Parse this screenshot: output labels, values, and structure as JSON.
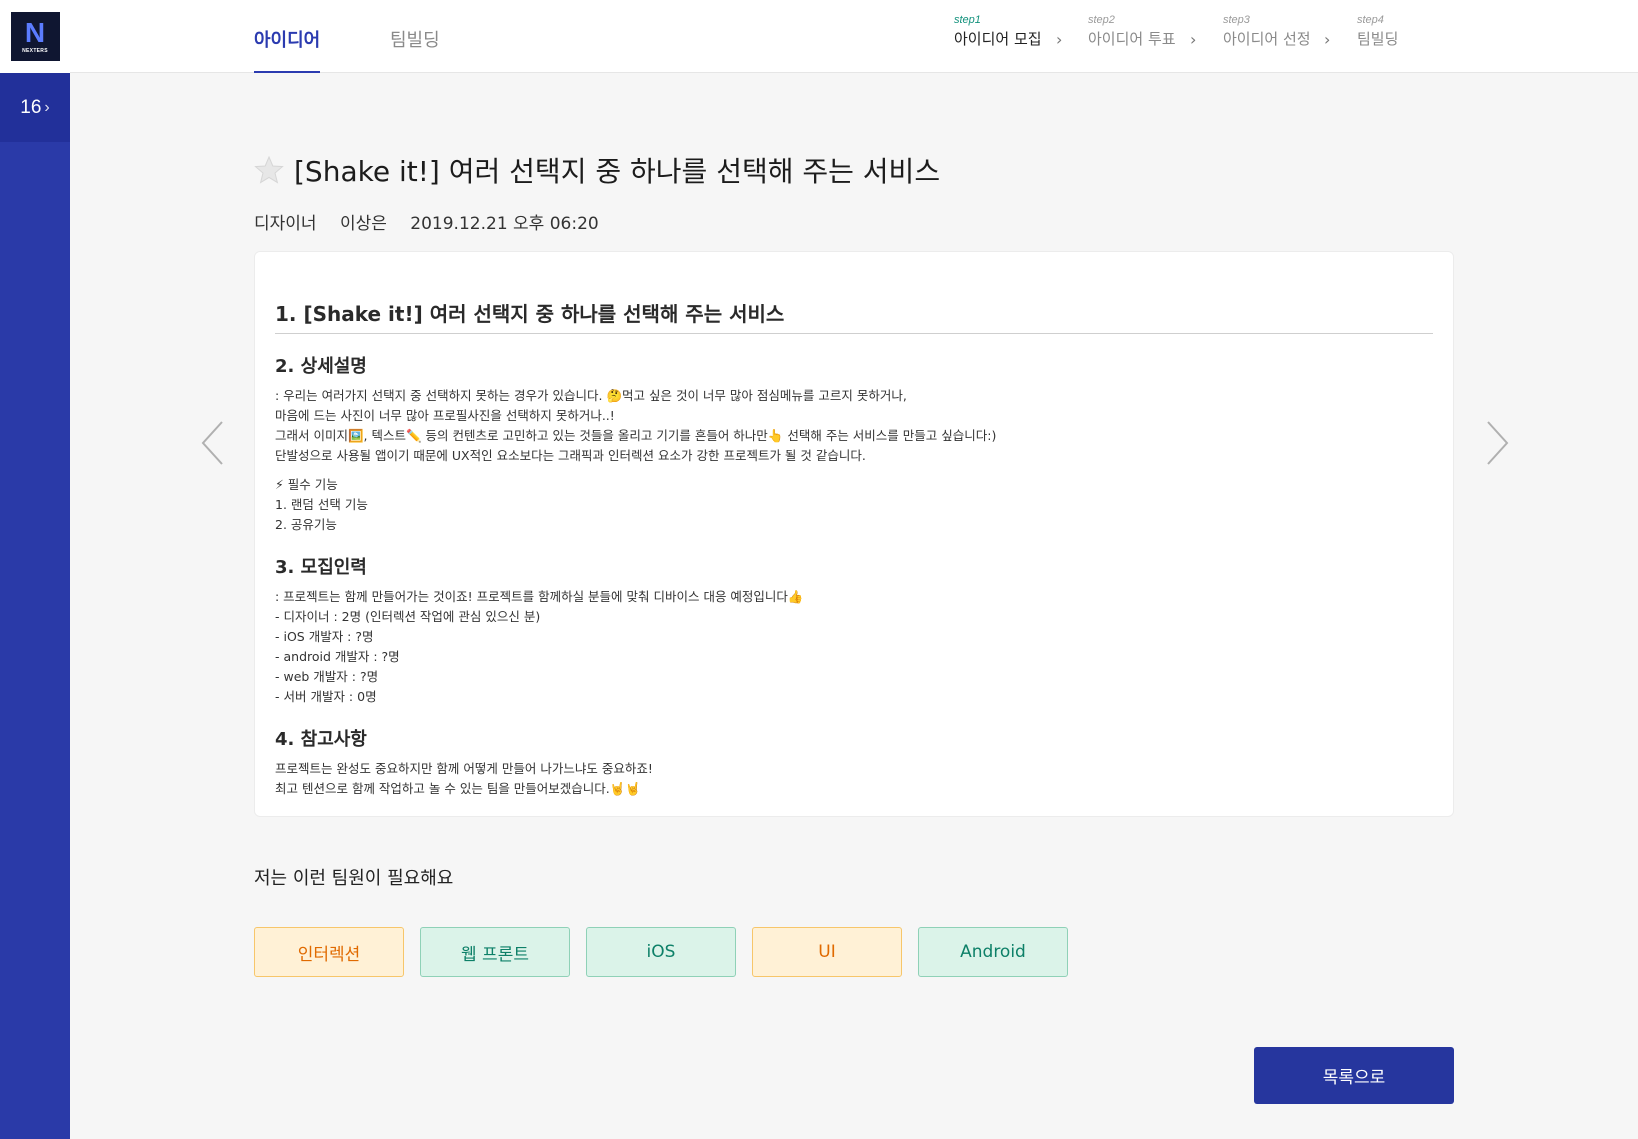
{
  "brand": {
    "logo_text": "NEXTERS"
  },
  "sidebar": {
    "generation": "16",
    "generation_chevron": "›"
  },
  "nav": {
    "tabs": [
      {
        "label": "아이디어",
        "active": true
      },
      {
        "label": "팀빌딩",
        "active": false
      }
    ],
    "steps": [
      {
        "step": "step1",
        "name": "아이디어 모집",
        "active": true
      },
      {
        "step": "step2",
        "name": "아이디어 투표",
        "active": false
      },
      {
        "step": "step3",
        "name": "아이디어 선정",
        "active": false
      },
      {
        "step": "step4",
        "name": "팀빌딩",
        "active": false
      }
    ],
    "separator": "›"
  },
  "idea": {
    "title": "[Shake it!] 여러 선택지 중 하나를 선택해 주는 서비스",
    "role": "디자이너",
    "author": "이상은",
    "date": "2019.12.21 오후 06:20"
  },
  "content": {
    "h1": "1. [Shake it!] 여러 선택지 중 하나를 선택해 주는 서비스",
    "sec2_title": "2. 상세설명",
    "sec2_lines": [
      ": 우리는 여러가지 선택지 중 선택하지 못하는 경우가 있습니다. 🤔먹고 싶은 것이 너무 많아 점심메뉴를 고르지 못하거나,",
      "마음에 드는 사진이 너무 많아 프로필사진을 선택하지 못하거나..!",
      "그래서 이미지🖼️, 텍스트✏️ 등의 컨텐츠로 고민하고 있는 것들을 올리고 기기를 흔들어 하나만👆 선택해 주는 서비스를 만들고 싶습니다:)",
      "단발성으로 사용될 앱이기 때문에 UX적인 요소보다는 그래픽과 인터렉션 요소가 강한 프로젝트가 될 것 같습니다."
    ],
    "features_lines": [
      "⚡ 필수 기능",
      "1. 랜덤 선택 기능",
      "2. 공유기능"
    ],
    "sec3_title": "3. 모집인력",
    "sec3_lines": [
      ": 프로젝트는 함께 만들어가는 것이죠! 프로젝트를 함께하실 분들에 맞춰 디바이스 대응 예정입니다👍",
      "- 디자이너 : 2명 (인터렉션 작업에 관심 있으신 분)",
      "- iOS 개발자 : ?명",
      "- android 개발자 : ?명",
      "- web 개발자 : ?명",
      "- 서버 개발자 : 0명"
    ],
    "sec4_title": "4. 참고사항",
    "sec4_lines": [
      "프로젝트는 완성도 중요하지만 함께 어떻게 만들어 나가느냐도 중요하죠!",
      "최고 텐션으로 함께 작업하고 놀 수 있는 팀을 만들어보겠습니다.🤘🤘"
    ]
  },
  "needs": {
    "title": "저는 이런 팀원이 필요해요",
    "chips": [
      {
        "label": "인터렉션",
        "color": "orange"
      },
      {
        "label": "웹 프론트",
        "color": "green"
      },
      {
        "label": "iOS",
        "color": "green"
      },
      {
        "label": "UI",
        "color": "orange"
      },
      {
        "label": "Android",
        "color": "green"
      }
    ]
  },
  "actions": {
    "list_button": "목록으로"
  },
  "colors": {
    "primary": "#2a3aa8",
    "step_active": "#12917c",
    "chip_orange": "#e06a00",
    "chip_green": "#0d8068"
  }
}
